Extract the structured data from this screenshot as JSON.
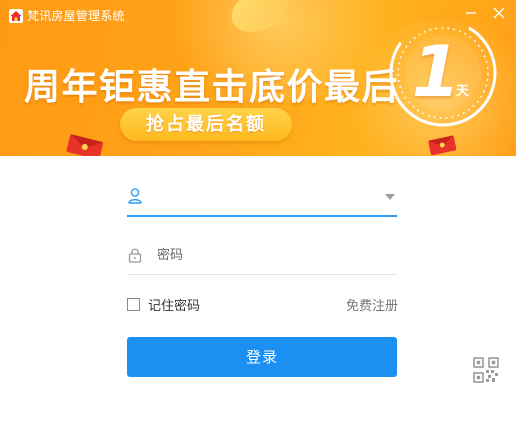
{
  "window": {
    "app_title": "梵讯房屋管理系统"
  },
  "banner": {
    "headline": "周年钜惠直击底价最后",
    "countdown_number": "1",
    "countdown_unit": "天",
    "cta_label": "抢占最后名额",
    "background_color": "#ffa318"
  },
  "login_form": {
    "username": {
      "value": "",
      "placeholder": ""
    },
    "password": {
      "value": "",
      "placeholder": "密码"
    },
    "remember_password_label": "记住密码",
    "remember_password_checked": false,
    "register_link": "免费注册",
    "login_button": "登录",
    "accent_color": "#1b8ff2"
  },
  "icons": {
    "logo": "house-logo-icon",
    "minimize": "minimize-icon",
    "close": "close-icon",
    "user": "user-icon",
    "lock": "lock-icon",
    "dropdown": "chevron-down-icon",
    "qr": "qr-code-icon"
  }
}
